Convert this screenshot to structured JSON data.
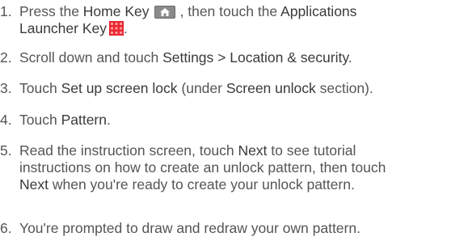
{
  "steps": [
    {
      "num": "1.",
      "line1": {
        "a": "Press the ",
        "b": "Home Key",
        "c": ", then touch the ",
        "d": "Applications"
      },
      "line2": {
        "a": "Launcher Key",
        "b": "."
      },
      "icons": [
        "home-key-icon",
        "apps-launcher-icon"
      ]
    },
    {
      "num": "2.",
      "line1": {
        "a": "Scroll down and touch ",
        "b": "Settings > Location & security",
        "c": "."
      }
    },
    {
      "num": "3.",
      "line1": {
        "a": "Touch ",
        "b": "Set up screen lock",
        "c": " (under ",
        "d": "Screen unlock",
        "e": " section)."
      }
    },
    {
      "num": "4.",
      "line1": {
        "a": "Touch ",
        "b": "Pattern",
        "c": "."
      }
    },
    {
      "num": "5.",
      "line1": {
        "a": "Read the instruction screen, touch ",
        "b": "Next",
        "c": " to see tutorial"
      },
      "line2": {
        "a": "instructions on how to create an unlock pattern, then touch"
      },
      "line3": {
        "a": "Next",
        "b": " when you're ready to create your unlock pattern."
      }
    },
    {
      "num": "6.",
      "line1": {
        "a": "You're prompted to draw and redraw your own pattern."
      }
    }
  ],
  "colors": {
    "text": "#555555",
    "emphasis": "#3a3a3a",
    "home_key_bg": "#8a8a8a",
    "apps_key_red": "#e8262f"
  }
}
